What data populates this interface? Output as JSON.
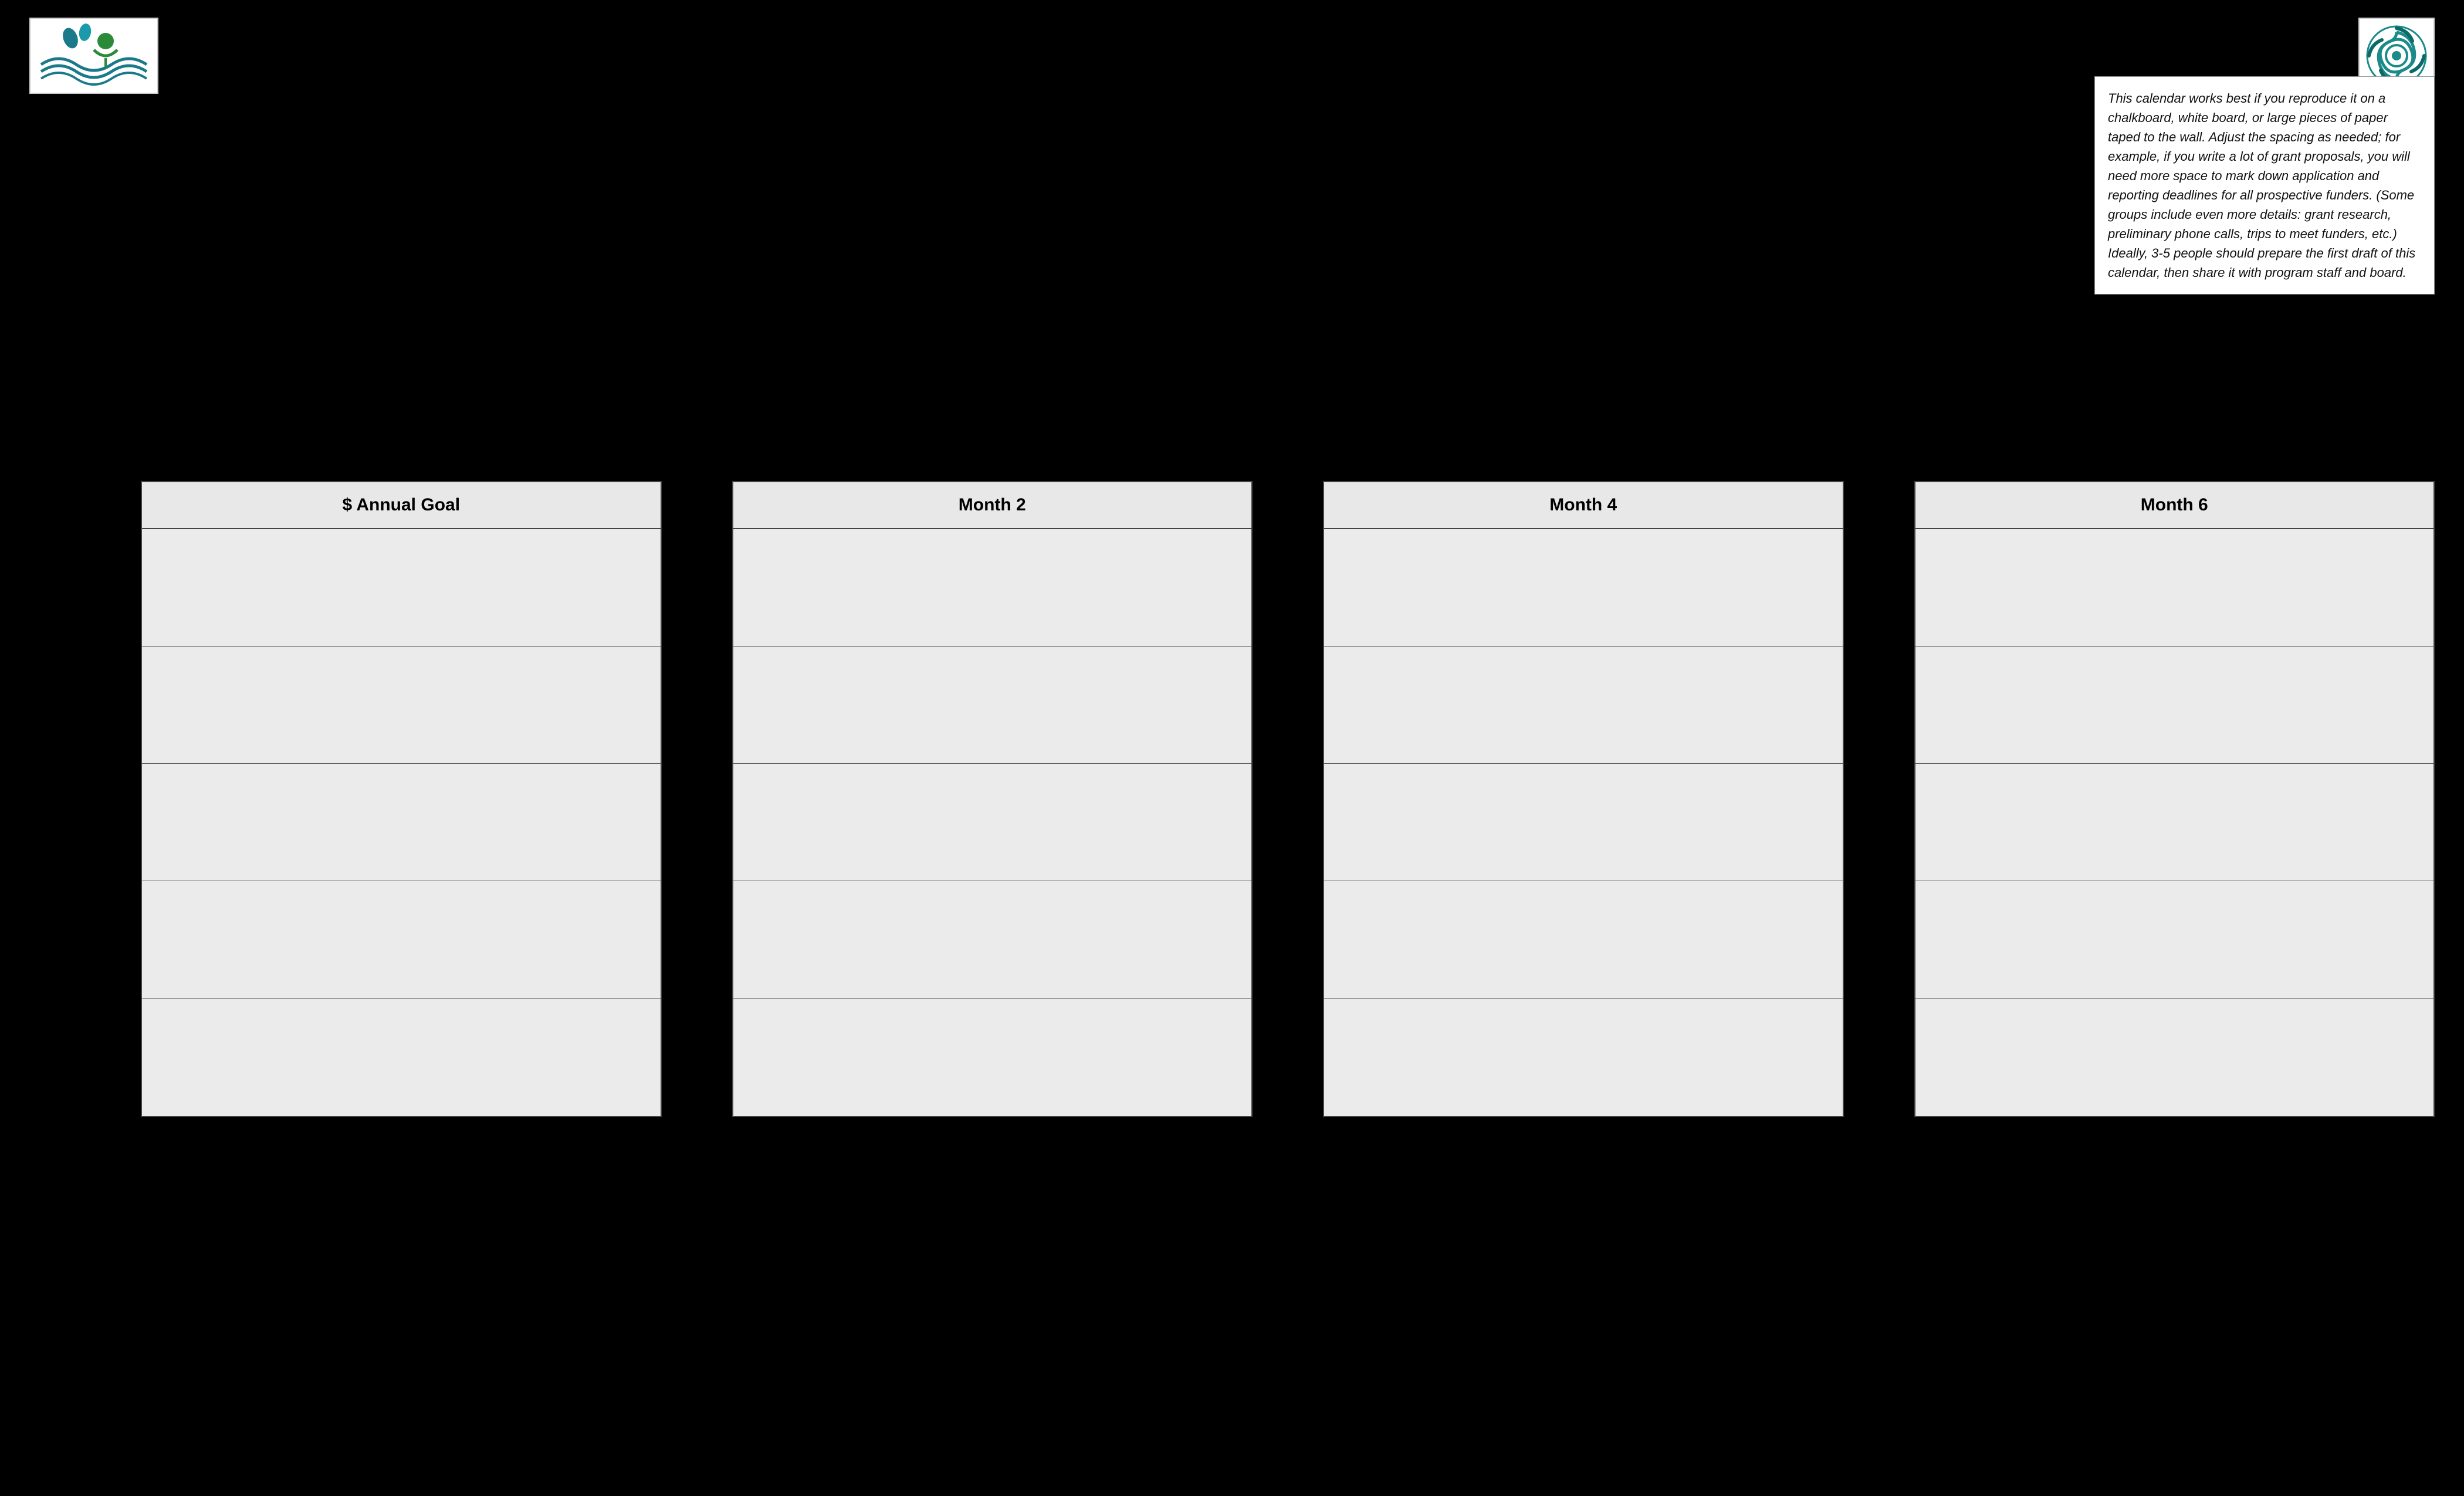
{
  "logos": {
    "left_alt": "Organization waves logo",
    "right_alt": "Circular organization logo"
  },
  "info_box": {
    "text": "This calendar works best if you reproduce it on a chalkboard, white board, or large pieces of paper taped to the wall.  Adjust the spacing as needed; for example, if you write a lot of grant proposals, you will need more space to mark down application and reporting deadlines for all prospective funders. (Some groups include even more details: grant research, preliminary phone calls, trips to meet funders, etc.)  Ideally, 3-5 people should prepare the first draft of this calendar, then share it with program staff and board."
  },
  "columns": [
    {
      "header": "$ Annual Goal",
      "rows": 5
    },
    {
      "header": "Month 2",
      "rows": 5
    },
    {
      "header": "Month 4",
      "rows": 5
    },
    {
      "header": "Month 6",
      "rows": 5
    }
  ]
}
